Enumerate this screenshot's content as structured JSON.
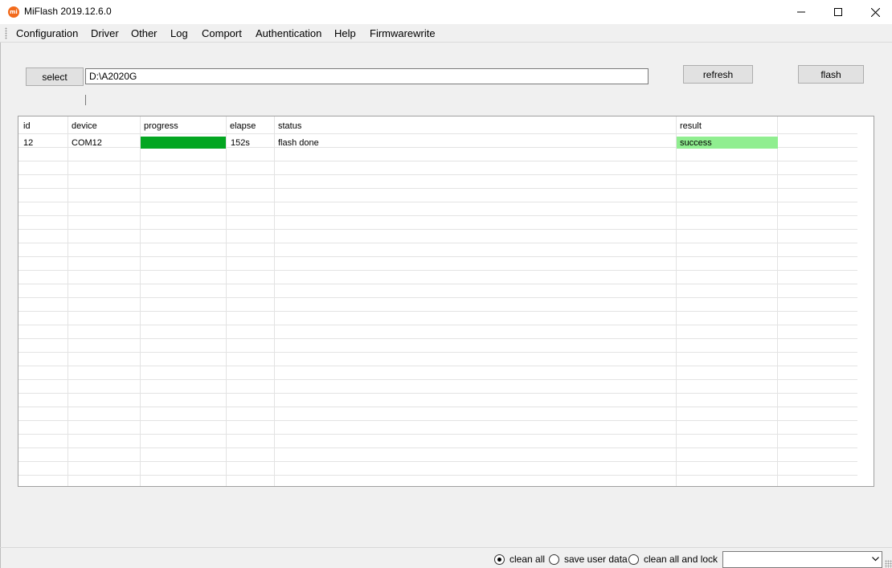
{
  "window": {
    "title": "MiFlash 2019.12.6.0",
    "icon_text": "mi",
    "icon_color": "#f26a1b"
  },
  "menu": [
    {
      "label": "Configuration"
    },
    {
      "label": "Driver"
    },
    {
      "label": "Other"
    },
    {
      "label": "Log"
    },
    {
      "label": "Comport"
    },
    {
      "label": "Authentication"
    },
    {
      "label": "Help"
    },
    {
      "label": "Firmwarewrite"
    }
  ],
  "toolbar": {
    "select_label": "select",
    "path_value": "D:\\A2020G",
    "refresh_label": "refresh",
    "flash_label": "flash"
  },
  "grid": {
    "columns": [
      "id",
      "device",
      "progress",
      "elapse",
      "status",
      "result"
    ],
    "rows": [
      {
        "id": "12",
        "device": "COM12",
        "progress": 1.0,
        "elapse": "152s",
        "status": "flash done",
        "result": "success"
      }
    ],
    "progress_color": "#03a621",
    "success_color": "#90ee90"
  },
  "bottom": {
    "options": [
      {
        "label": "clean all",
        "checked": true
      },
      {
        "label": "save user data",
        "checked": false
      },
      {
        "label": "clean all and lock",
        "checked": false
      }
    ],
    "combo_value": ""
  }
}
